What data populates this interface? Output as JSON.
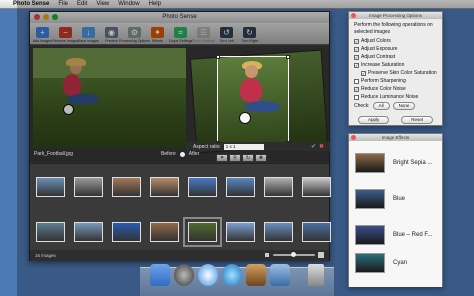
{
  "menubar": {
    "app": "Photo Sense",
    "items": [
      "File",
      "Edit",
      "View",
      "Window",
      "Help"
    ]
  },
  "window": {
    "title": "Photo Sense"
  },
  "toolbar": [
    {
      "label": "Add Images",
      "icon": "add-images-icon",
      "color": "#3a7bd5",
      "glyph": "+"
    },
    {
      "label": "Remove Images",
      "icon": "remove-images-icon",
      "color": "#c0392b",
      "glyph": "−"
    },
    {
      "label": "Save Images",
      "icon": "save-images-icon",
      "color": "#4a90d9",
      "glyph": "↓"
    },
    {
      "label": "Preview",
      "icon": "preview-icon",
      "color": "#5d6d7e",
      "glyph": "◉"
    },
    {
      "label": "Processing Options",
      "icon": "processing-options-icon",
      "color": "#7f8c8d",
      "glyph": "⚙"
    },
    {
      "label": "Effects",
      "icon": "effects-icon",
      "color": "#d35400",
      "glyph": "✦"
    },
    {
      "label": "Crops Settings",
      "icon": "crops-settings-icon",
      "color": "#27ae60",
      "glyph": "⌗"
    },
    {
      "label": "Photo Settings",
      "icon": "photo-settings-icon",
      "color": "#888888",
      "glyph": "☰"
    },
    {
      "label": "Turn Left",
      "icon": "turn-left-icon",
      "color": "#2c3e50",
      "glyph": "↺"
    },
    {
      "label": "Turn Right",
      "icon": "turn-right-icon",
      "color": "#2c3e50",
      "glyph": "↻"
    }
  ],
  "filename": "Park_Football.jpg",
  "before_label": "Before",
  "after_label": "After",
  "aspect": {
    "label": "Aspect ratio:",
    "value": "1 x 1"
  },
  "status": "16 images",
  "processing_panel": {
    "title": "Image Processing Options",
    "intro": "Perform the following operations on selected images",
    "options": [
      {
        "label": "Adjust Colors",
        "checked": true,
        "indent": false
      },
      {
        "label": "Adjust Exposure",
        "checked": true,
        "indent": false
      },
      {
        "label": "Adjust Contrast",
        "checked": true,
        "indent": false
      },
      {
        "label": "Increase Saturation",
        "checked": true,
        "indent": false
      },
      {
        "label": "Preserve Skin Color Saturation",
        "checked": true,
        "indent": true
      },
      {
        "label": "Perform Sharpening",
        "checked": false,
        "indent": false
      },
      {
        "label": "Reduce Color Noise",
        "checked": true,
        "indent": false
      },
      {
        "label": "Reduce Luminance Noise",
        "checked": false,
        "indent": false
      }
    ],
    "check_label": "Check:",
    "all_label": "All",
    "none_label": "None",
    "apply_label": "Apply",
    "reset_label": "Reset"
  },
  "effects_panel": {
    "title": "Image Effects",
    "effects": [
      {
        "label": "Bright Sepia ...",
        "color": "#8a6a48"
      },
      {
        "label": "Blue",
        "color": "#3c5f86"
      },
      {
        "label": "Blue – Red F...",
        "color": "#3a4f8a"
      },
      {
        "label": "Cyan",
        "color": "#2c6f7a"
      }
    ]
  },
  "thumbnails_row1": [
    "#6b8fb5",
    "#9a9a9a",
    "#a07a5a",
    "#b58d6a",
    "#4a78c8",
    "#5a86c0",
    "#b0b0b0",
    "#c8c8c8"
  ],
  "thumbnails_row2": [
    "#5d7e8f",
    "#7a9ab8",
    "#2a5ab0",
    "#8e6b48",
    "#4e6b2c",
    "#7aa0d0",
    "#6a8fbf",
    "#4a6fa0"
  ]
}
